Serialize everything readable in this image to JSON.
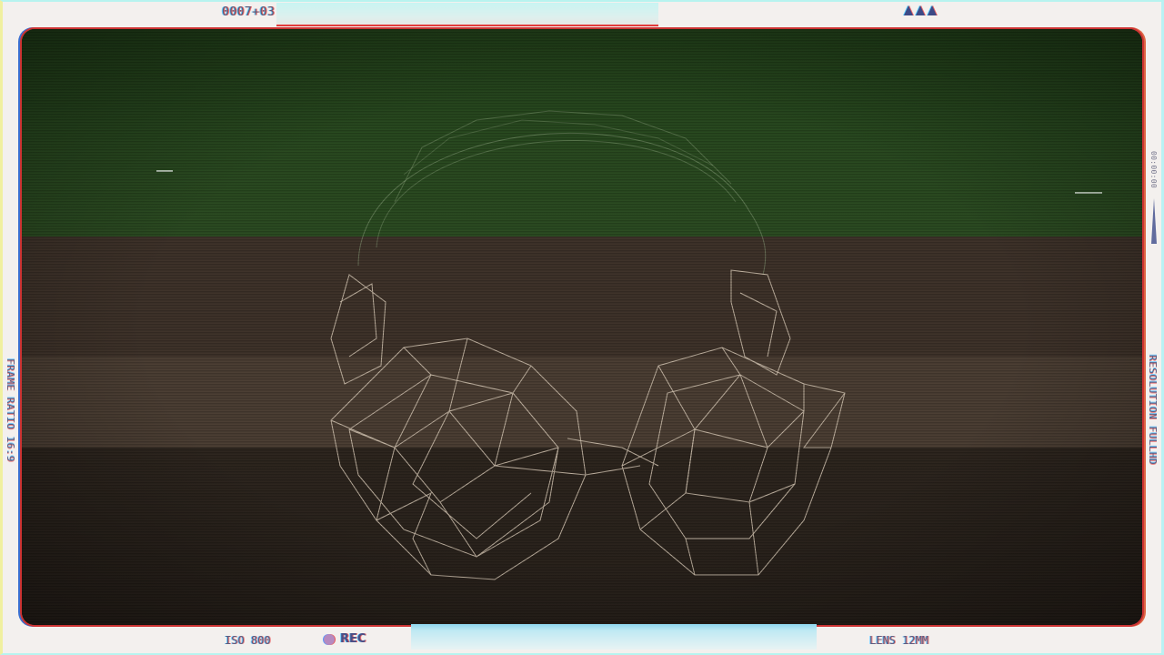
{
  "hud": {
    "timecode": "0007+03",
    "battery_icon": "battery-triangles-icon",
    "side_left": "FRAME RATIO 16:9",
    "side_right": "RESOLUTION FULLHD",
    "side_right_timecode": "00:00:00",
    "iso": "ISO 800",
    "rec": "REC",
    "lens": "LENS 12MM"
  },
  "colors": {
    "rec_dot": "#b58ac0",
    "hud_text": "#5b5b7e",
    "screen_green": "#27481e",
    "screen_brown": "#3d3128",
    "wireframe": "#d8c9b6"
  },
  "screen": {
    "subject_icon": "wireframe-headphones-icon"
  }
}
